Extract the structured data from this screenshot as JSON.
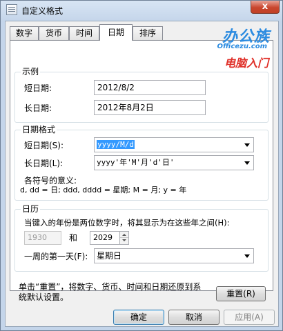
{
  "window": {
    "title": "自定义格式",
    "close_glyph": "x"
  },
  "tabs": [
    {
      "label": "数字"
    },
    {
      "label": "货币"
    },
    {
      "label": "时间"
    },
    {
      "label": "日期"
    },
    {
      "label": "排序"
    }
  ],
  "watermark": {
    "brand": "办公族",
    "site": "Officezu.com",
    "tagline": "电脑入门"
  },
  "example": {
    "group_label": "示例",
    "short_label": "短日期:",
    "short_value": "2012/8/2",
    "long_label": "长日期:",
    "long_value": "2012年8月2日"
  },
  "date_formats": {
    "group_label": "日期格式",
    "short_label": "短日期(S):",
    "short_value": "yyyy/M/d",
    "long_label": "长日期(L):",
    "long_value": "yyyy'年'M'月'd'日'",
    "symbols_title": "各符号的意义:",
    "symbols_text": "d, dd = 日;  ddd, dddd = 星期;  M = 月;  y = 年"
  },
  "calendar": {
    "group_label": "日历",
    "two_digit_text": "当键入的年份是两位数字时，将其显示为在这些年之间(H):",
    "year_from": "1930",
    "and_label": "和",
    "year_to": "2029",
    "first_day_label": "一周的第一天(F):",
    "first_day_value": "星期日"
  },
  "reset": {
    "note_line1": "单击“重置”，将数字、货币、时间和日期还原到系",
    "note_line2": "统默认设置。",
    "button_label": "重置(R)"
  },
  "buttons": {
    "ok": "确定",
    "cancel": "取消",
    "apply": "应用(A)"
  }
}
